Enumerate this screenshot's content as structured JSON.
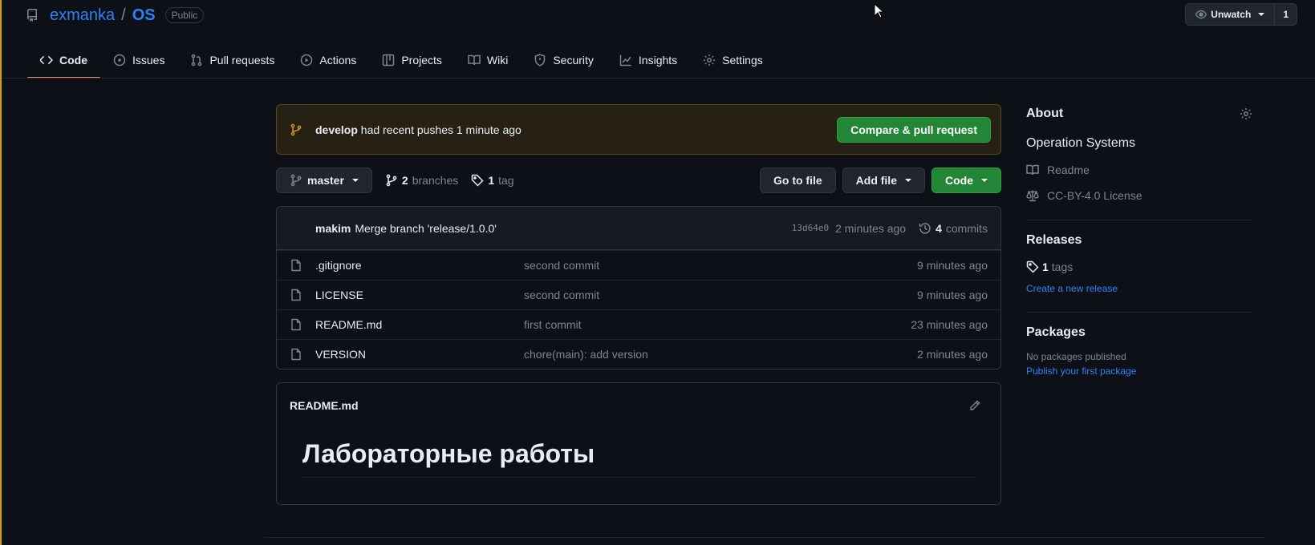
{
  "repo": {
    "owner": "exmanka",
    "separator": "/",
    "name": "OS",
    "visibility": "Public"
  },
  "watch": {
    "label": "Unwatch",
    "count": "1"
  },
  "tabs": [
    {
      "label": "Code",
      "icon": "code-icon"
    },
    {
      "label": "Issues",
      "icon": "issue-icon"
    },
    {
      "label": "Pull requests",
      "icon": "pull-request-icon"
    },
    {
      "label": "Actions",
      "icon": "play-icon"
    },
    {
      "label": "Projects",
      "icon": "table-icon"
    },
    {
      "label": "Wiki",
      "icon": "book-icon"
    },
    {
      "label": "Security",
      "icon": "shield-icon"
    },
    {
      "label": "Insights",
      "icon": "graph-icon"
    },
    {
      "label": "Settings",
      "icon": "gear-icon"
    }
  ],
  "push_banner": {
    "branch": "develop",
    "text": "had recent pushes 1 minute ago",
    "button": "Compare & pull request"
  },
  "filebar": {
    "branch": "master",
    "branches_count": "2",
    "branches_label": "branches",
    "tags_count": "1",
    "tags_label": "tag",
    "go_to_file": "Go to file",
    "add_file": "Add file",
    "code": "Code"
  },
  "latest_commit": {
    "author": "makim",
    "message": "Merge branch 'release/1.0.0'",
    "sha": "13d64e0",
    "ago": "2 minutes ago",
    "commits_count": "4",
    "commits_label": "commits"
  },
  "files": [
    {
      "name": ".gitignore",
      "message": "second commit",
      "ago": "9 minutes ago"
    },
    {
      "name": "LICENSE",
      "message": "second commit",
      "ago": "9 minutes ago"
    },
    {
      "name": "README.md",
      "message": "first commit",
      "ago": "23 minutes ago"
    },
    {
      "name": "VERSION",
      "message": "chore(main): add version",
      "ago": "2 minutes ago"
    }
  ],
  "readme": {
    "title": "README.md",
    "heading": "Лабораторные работы"
  },
  "about": {
    "title": "About",
    "description": "Operation Systems",
    "readme_link": "Readme",
    "license_link": "CC-BY-4.0 License"
  },
  "releases": {
    "title": "Releases",
    "tags_count": "1",
    "tags_label": "tags",
    "create_link": "Create a new release"
  },
  "packages": {
    "title": "Packages",
    "none_text": "No packages published",
    "publish_link": "Publish your first package"
  },
  "colors": {
    "background": "#0d1117",
    "accent_blue": "#2f81f7",
    "green_button": "#238636",
    "tab_underline": "#f78166",
    "banner_icon": "#d29922"
  }
}
